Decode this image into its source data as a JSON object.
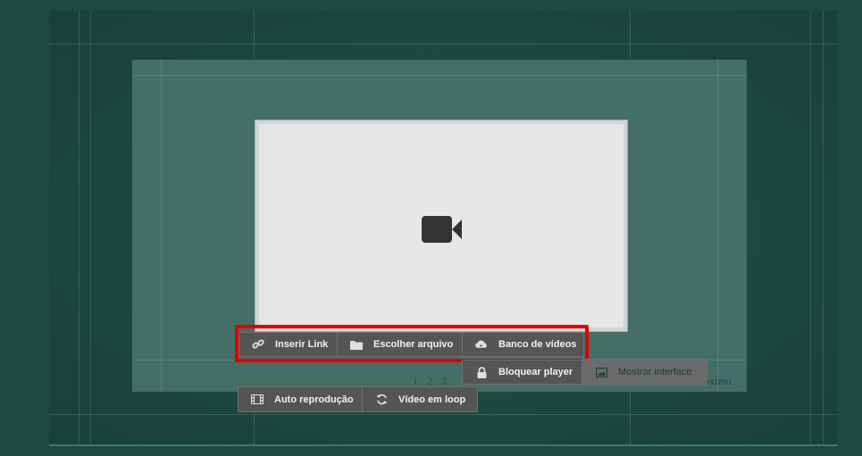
{
  "toolbar_primary": {
    "insert_link": "Inserir Link",
    "choose_file": "Escolher arquivo",
    "video_bank": "Banco de vídeos"
  },
  "toolbar_secondary": {
    "lock_player": "Bloquear player",
    "show_interface": "Mostrar interface"
  },
  "toolbar_tertiary": {
    "autoplay": "Auto reprodução",
    "loop": "Vídeo em loop"
  },
  "pager": {
    "pages": [
      "1",
      "2",
      "3"
    ],
    "next_label": "óximo"
  },
  "icons": {
    "video_placeholder": "video-camera-icon",
    "insert_link": "link-icon",
    "choose_file": "folder-icon",
    "video_bank": "cloud-icon",
    "lock_player": "lock-icon",
    "show_interface": "image-icon",
    "autoplay": "film-icon",
    "loop": "refresh-icon"
  },
  "colors": {
    "background": "#1f4a3f",
    "canvas": "#456f66",
    "button": "#555555",
    "highlight": "#e00000"
  }
}
